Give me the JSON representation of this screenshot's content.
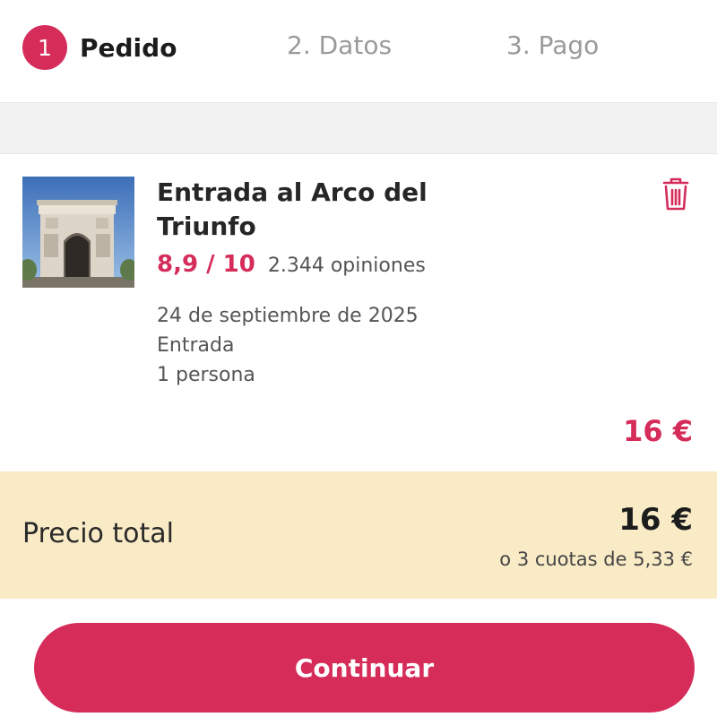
{
  "steps": {
    "active": {
      "number": "1",
      "label": "Pedido"
    },
    "step2": "2. Datos",
    "step3": "3. Pago"
  },
  "product": {
    "title": "Entrada al Arco del Triunfo",
    "rating": "8,9 / 10",
    "reviews": "2.344 opiniones",
    "date": "24 de septiembre de 2025",
    "ticket_type": "Entrada",
    "people": "1 persona",
    "price": "16 €",
    "image_subject": "arc-de-triomphe-photo",
    "delete_icon": "trash-icon"
  },
  "total": {
    "label": "Precio total",
    "price": "16 €",
    "installments": "o 3 cuotas de 5,33 €"
  },
  "continue_label": "Continuar",
  "colors": {
    "accent": "#d52c5a",
    "total_bg": "#faebc7",
    "band_bg": "#f2f2f2"
  }
}
